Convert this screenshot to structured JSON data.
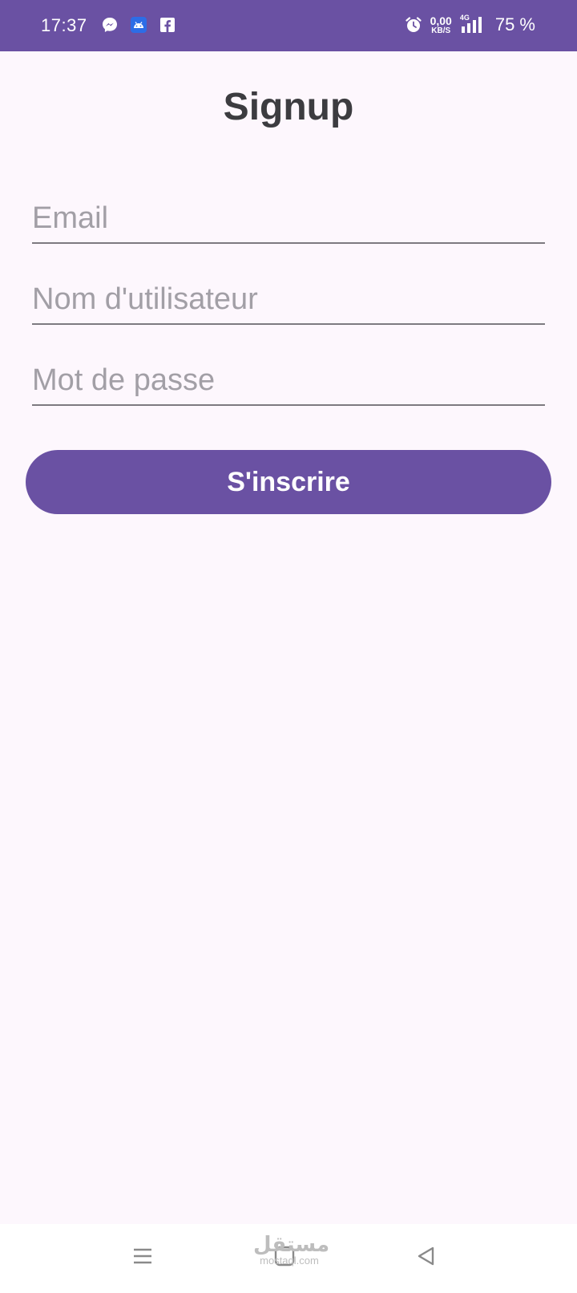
{
  "status_bar": {
    "time": "17:37",
    "notification_icons": [
      "messenger-icon",
      "android-icon",
      "facebook-icon"
    ],
    "alarm_icon": "alarm-clock-icon",
    "data_rate": "0,00",
    "data_rate_unit": "KB/S",
    "network_type": "4G",
    "signal_icon": "signal-bars-icon",
    "battery": "75 %"
  },
  "page": {
    "title": "Signup"
  },
  "form": {
    "email_placeholder": "Email",
    "username_placeholder": "Nom d'utilisateur",
    "password_placeholder": "Mot de passe",
    "submit_label": "S'inscrire"
  },
  "nav_bar": {
    "menu_icon": "menu-icon",
    "home_icon": "home-square-icon",
    "back_icon": "back-triangle-icon"
  },
  "watermark": {
    "arabic": "مستقل",
    "latin": "mostaql.com"
  },
  "colors": {
    "accent": "#6a51a3",
    "background": "#fdf7fd",
    "title_text": "#3c3c40",
    "placeholder_text": "#a29fa6",
    "field_underline": "#7d7a80"
  }
}
